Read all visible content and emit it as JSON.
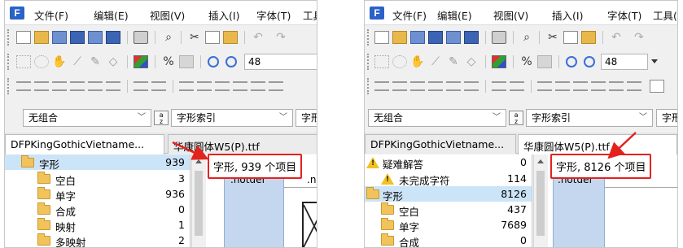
{
  "menu": [
    "文件(F)",
    "编辑(E)",
    "视图(V)",
    "插入(I)",
    "字体(T)",
    "工具(L)"
  ],
  "toolbar": {
    "zoom_value": "48"
  },
  "combo": {
    "group_value": "无组合",
    "index_value": "字形索引",
    "index_value_clipped": "字形"
  },
  "left": {
    "tab_active": "DFPKingGothicVietname...",
    "tab_other": "华康圆体W5(P).ttf",
    "status": "字形, 939 个项目",
    "cell_name": ".notdef",
    "cell_name_2": ".no",
    "tree": [
      {
        "label": "字形",
        "count": "939"
      },
      {
        "label": "空白",
        "count": "3"
      },
      {
        "label": "单字",
        "count": "936"
      },
      {
        "label": "合成",
        "count": "0"
      },
      {
        "label": "映射",
        "count": "1"
      },
      {
        "label": "多映射",
        "count": "2"
      }
    ]
  },
  "right": {
    "tab_active": "DFPKingGothicVietname...",
    "tab_other": "华康圆体W5(P).ttf",
    "status": "字形, 8126 个项目",
    "cell_name": ".notdef",
    "tree": [
      {
        "label": "疑难解答",
        "count": "0"
      },
      {
        "label": "未完成字符",
        "count": "114"
      },
      {
        "label": "字形",
        "count": "8126"
      },
      {
        "label": "空白",
        "count": "437"
      },
      {
        "label": "单字",
        "count": "7689"
      },
      {
        "label": "合成",
        "count": "0"
      }
    ]
  },
  "colors": {
    "annotation_red": "#e3221e",
    "selection_blue": "#cce4f7",
    "folder_yellow": "#f1c35a"
  }
}
